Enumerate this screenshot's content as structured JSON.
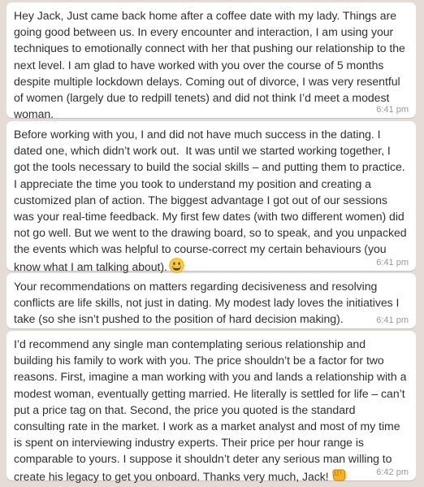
{
  "messages": [
    {
      "text": "Hey Jack, Just came back home after a coffee date with my lady. Things are going good between us. In every encounter and interaction, I am using your techniques to emotionally connect with her that pushing our relationship to the next level. I am glad to have worked with you over the course of 5 months despite multiple lockdown delays. Coming out of divorce, I was very resentful of women (largely due to redpill tenets) and did not think I’d meet a modest woman.",
      "time": "6:41 pm"
    },
    {
      "text": "Before working with you, I and did not have much success in the dating. I dated one, which didn’t work out.  It was until we started working together, I got the tools necessary to build the social skills – and putting them to practice. I appreciate the time you took to understand my position and creating a customized plan of action. The biggest advantage I got out of our sessions was your real-time feedback. My first few dates (with two different women) did not go well. But we went to the drawing board, so to speak, and you unpacked the events which was helpful to course-correct my certain behaviours (you know what I am talking about).",
      "emoji": "grinning-face-emoji",
      "time": "6:41 pm"
    },
    {
      "text": "Your recommendations on matters regarding decisiveness and resolving conflicts are life skills, not just in dating. My modest lady loves the initiatives I take (so she isn’t pushed to the position of hard decision making).",
      "time": "6:41 pm"
    },
    {
      "text": "I’d recommend any single man contemplating serious relationship and building his family to work with you. The price shouldn’t be a factor for two reasons. First, imagine a man working with you and lands a relationship with a modest woman, eventually getting married. He literally is settled for life – can’t put a price tag on that. Second, the price you quoted is the standard consulting rate in the market. I work as a market analyst and most of my time is spent on interviewing industry experts. Their price per hour range is comparable to yours. I suppose it shouldn’t deter any serious man willing to create his legacy to get you onboard. Thanks very much, Jack!",
      "emoji": "fist-bump-emoji",
      "time": "6:42 pm"
    }
  ],
  "colors": {
    "chat_background": "#e5ddd5",
    "bubble": "#ffffff",
    "text": "#303030",
    "timestamp": "#999999"
  }
}
